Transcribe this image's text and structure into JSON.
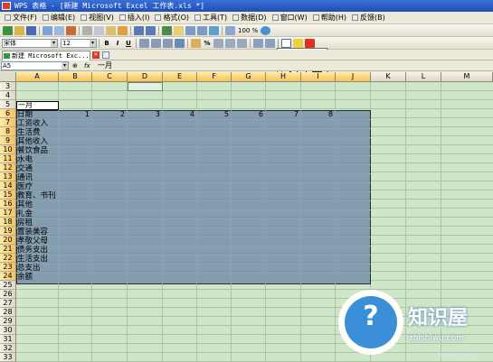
{
  "window": {
    "title": "WPS 表格 - [新建 Microsoft Excel 工作表.xls *]"
  },
  "menu": [
    {
      "label": "文件(F)",
      "icon": "file-menu-icon"
    },
    {
      "label": "编辑(E)",
      "icon": "edit-menu-icon"
    },
    {
      "label": "视图(V)",
      "icon": "view-menu-icon"
    },
    {
      "label": "插入(I)",
      "icon": "insert-menu-icon"
    },
    {
      "label": "格式(O)",
      "icon": "format-menu-icon"
    },
    {
      "label": "工具(T)",
      "icon": "tools-menu-icon"
    },
    {
      "label": "数据(D)",
      "icon": "data-menu-icon"
    },
    {
      "label": "窗口(W)",
      "icon": "window-menu-icon"
    },
    {
      "label": "帮助(H)",
      "icon": "help-menu-icon"
    },
    {
      "label": "反馈(B)",
      "icon": "feedback-menu-icon"
    }
  ],
  "toolbar": {
    "zoom": "100 %",
    "font_name": "宋体",
    "font_size": "12",
    "bold": "B",
    "italic": "I",
    "underline": "U",
    "percent": "%"
  },
  "tabs": [
    {
      "label": "新建 Microsoft Exc..."
    }
  ],
  "formula_bar": {
    "name_box": "A5",
    "fx": "fx",
    "value": "一月"
  },
  "columns": [
    "A",
    "B",
    "C",
    "D",
    "E",
    "F",
    "G",
    "H",
    "I",
    "J",
    "K",
    "L",
    "M"
  ],
  "rows": [
    "3",
    "4",
    "5",
    "6",
    "7",
    "8",
    "9",
    "10",
    "11",
    "12",
    "13",
    "14",
    "15",
    "16",
    "17",
    "18",
    "19",
    "20",
    "21",
    "22",
    "23",
    "24",
    "25",
    "26",
    "27",
    "28",
    "29",
    "30",
    "31",
    "32",
    "33"
  ],
  "cells": {
    "active_value": "一月",
    "column_a": [
      "日期",
      "工资收入",
      "生活费",
      "其他收入",
      "餐饮食品",
      "水电",
      "交通",
      "通讯",
      "医疗",
      "教育、书刊",
      "其他",
      "礼金",
      "房租",
      "置装美容",
      "孝敬父母",
      "债务支出",
      "生活支出",
      "总支出",
      "余额"
    ],
    "row6_numbers": [
      "1",
      "2",
      "3",
      "4",
      "5",
      "6",
      "7",
      "8"
    ]
  },
  "colors": {
    "title_bar": "#2a5ec8",
    "sheet_background": "#cfe6c8",
    "selection": "#7891aa",
    "selected_header": "#f7c35a"
  },
  "watermark": {
    "title": "知识屋",
    "url": "zhishiwu.com",
    "url2": "dexin.com"
  }
}
